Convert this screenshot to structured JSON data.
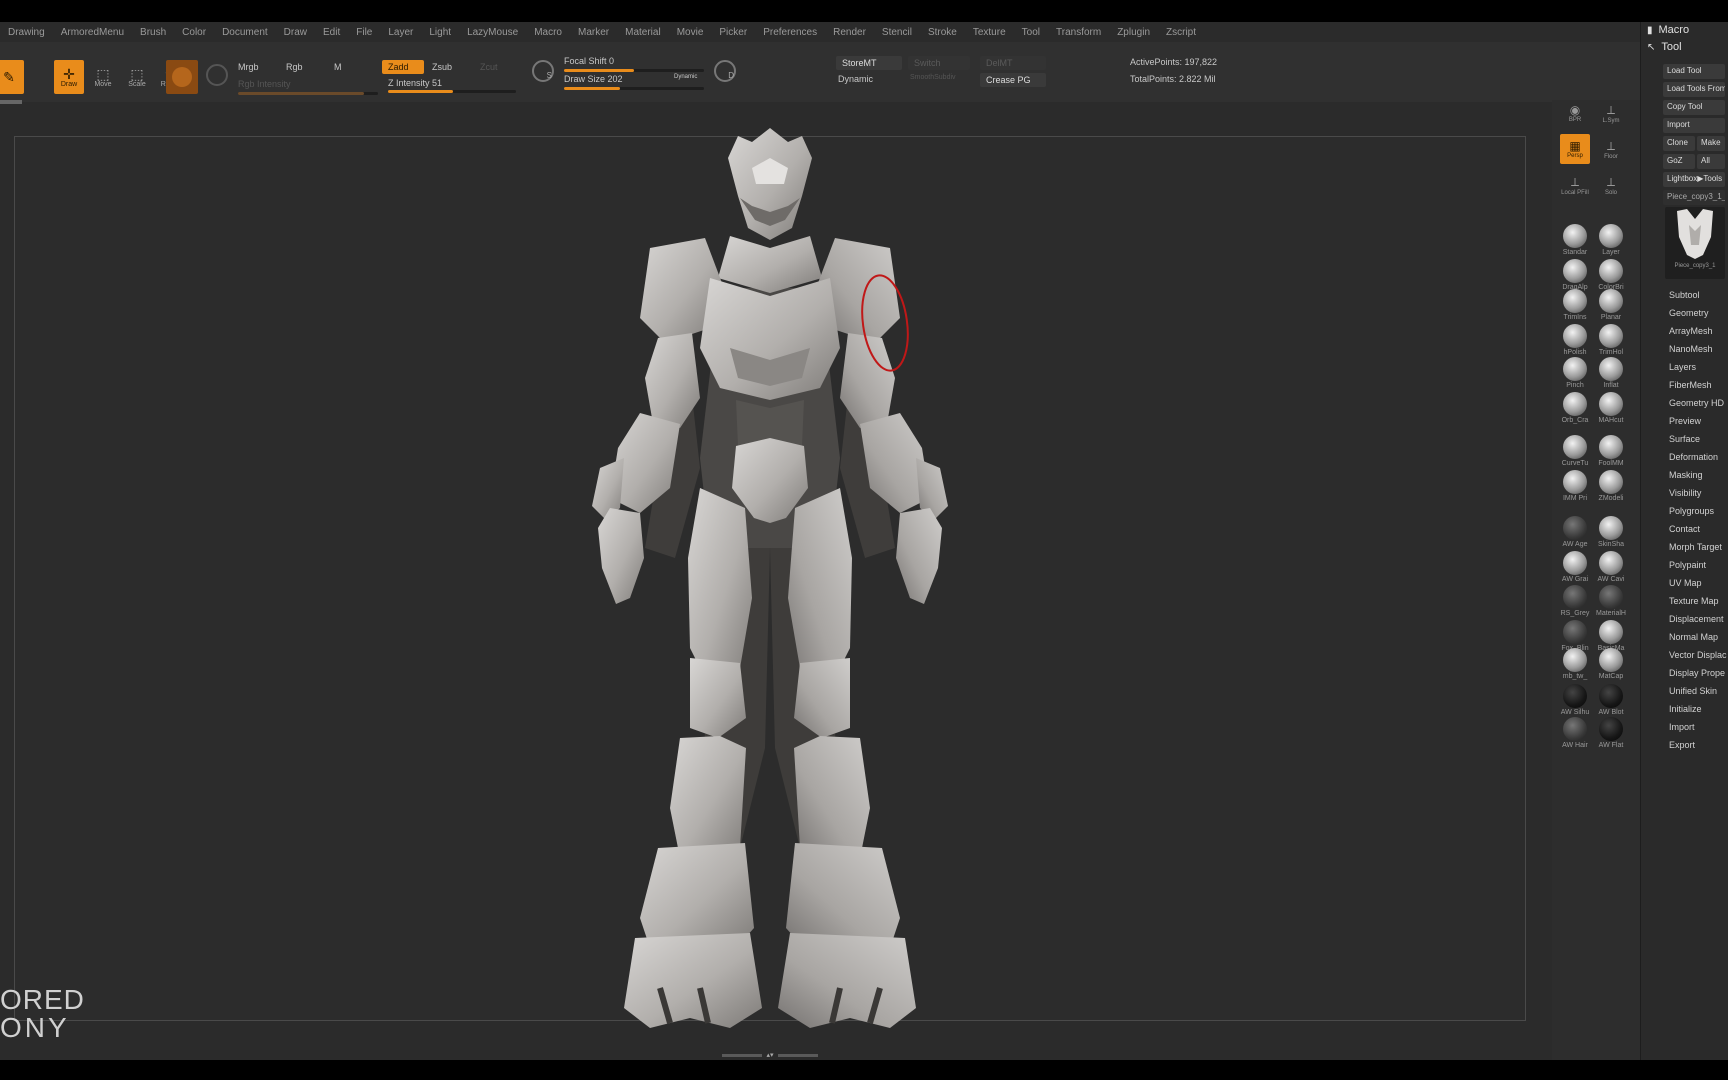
{
  "menu": [
    "Drawing",
    "ArmoredMenu",
    "Brush",
    "Color",
    "Document",
    "Draw",
    "Edit",
    "File",
    "Layer",
    "Light",
    "LazyMouse",
    "Macro",
    "Marker",
    "Material",
    "Movie",
    "Picker",
    "Preferences",
    "Render",
    "Stencil",
    "Stroke",
    "Texture",
    "Tool",
    "Transform",
    "Zplugin",
    "Zscript"
  ],
  "shelf": {
    "tools": [
      {
        "label": "",
        "glyph": "✎",
        "active": true
      },
      {
        "label": "Draw",
        "glyph": "✛",
        "active": true
      },
      {
        "label": "Move",
        "glyph": "⬚",
        "active": false
      },
      {
        "label": "Scale",
        "glyph": "⬚",
        "active": false
      },
      {
        "label": "Rotate",
        "glyph": "⟲",
        "active": false
      }
    ],
    "mrgb": "Mrgb",
    "rgb": "Rgb",
    "m": "M",
    "rgb_intensity": "Rgb Intensity",
    "zadd": "Zadd",
    "zsub": "Zsub",
    "zcut": "Zcut",
    "z_intensity": "Z Intensity 51",
    "focal_shift": "Focal Shift 0",
    "draw_size": "Draw Size 202",
    "dynamic_small": "Dynamic",
    "s_label": "S",
    "d_label": "D",
    "storemt": "StoreMT",
    "switch": "Switch",
    "delmt": "DelMT",
    "dynamic": "Dynamic",
    "smooth_subdiv": "SmoothSubdiv",
    "crease_pg": "Crease PG",
    "active_points": "ActivePoints: 197,822",
    "total_points": "TotalPoints: 2.822 Mil",
    "z_intensity_value": 0.51,
    "focal_shift_value": 0.5,
    "draw_size_value": 0.4,
    "rgb_intensity_value": 0.9
  },
  "watermark": {
    "line1": "ORED",
    "line2": "ONY"
  },
  "brush_palette": {
    "top_tiles": [
      {
        "label": "BPR",
        "orange": false
      },
      {
        "label": "L.Sym",
        "orange": false
      },
      {
        "label": "Persp",
        "orange": true
      },
      {
        "label": "Floor",
        "orange": false
      },
      {
        "label": "Local PFill",
        "orange": false
      },
      {
        "label": "Solo",
        "orange": false
      }
    ],
    "brushes": [
      {
        "label": "Standar",
        "style": ""
      },
      {
        "label": "Layer",
        "style": ""
      },
      {
        "label": "DragAlp",
        "style": ""
      },
      {
        "label": "ColorBri",
        "style": ""
      },
      {
        "label": "TrimIns",
        "style": ""
      },
      {
        "label": "Planar",
        "style": ""
      },
      {
        "label": "hPolish",
        "style": ""
      },
      {
        "label": "TrimHol",
        "style": ""
      },
      {
        "label": "Pinch",
        "style": ""
      },
      {
        "label": "Inflat",
        "style": ""
      },
      {
        "label": "Orb_Cra",
        "style": ""
      },
      {
        "label": "MAHcut",
        "style": ""
      },
      {
        "label": "CurveTu",
        "style": ""
      },
      {
        "label": "FoolMM",
        "style": ""
      },
      {
        "label": "IMM Pri",
        "style": ""
      },
      {
        "label": "ZModeli",
        "style": ""
      },
      {
        "label": "AW Age",
        "style": "dark"
      },
      {
        "label": "SkinSha",
        "style": ""
      },
      {
        "label": "AW Grai",
        "style": ""
      },
      {
        "label": "AW Cavi",
        "style": ""
      },
      {
        "label": "RS_Grey",
        "style": "dark"
      },
      {
        "label": "MaterialH",
        "style": "dark"
      },
      {
        "label": "Fox_Blin",
        "style": "dark"
      },
      {
        "label": "BasicMa",
        "style": ""
      },
      {
        "label": "mb_tw_",
        "style": ""
      },
      {
        "label": "MatCap",
        "style": ""
      },
      {
        "label": "AW Silhu",
        "style": "black"
      },
      {
        "label": "AW Blot",
        "style": "black"
      },
      {
        "label": "AW Hair",
        "style": "dark"
      },
      {
        "label": "AW Flat",
        "style": "black"
      }
    ]
  },
  "tool_palette": {
    "macro": "Macro",
    "tool": "Tool",
    "load_tool": "Load Tool",
    "load_tools_from": "Load Tools From",
    "copy_tool": "Copy Tool",
    "import": "Import",
    "clone": "Clone",
    "make": "Make",
    "goz": "GoZ",
    "all": "All",
    "lightbox": "Lightbox▶Tools",
    "current_tool": "Piece_copy3_1_",
    "thumb_label": "Piece_copy3_1",
    "subpalettes": [
      "Subtool",
      "Geometry",
      "ArrayMesh",
      "NanoMesh",
      "Layers",
      "FiberMesh",
      "Geometry HD",
      "Preview",
      "Surface",
      "Deformation",
      "Masking",
      "Visibility",
      "Polygroups",
      "Contact",
      "Morph Target",
      "Polypaint",
      "UV Map",
      "Texture Map",
      "Displacement",
      "Normal Map",
      "Vector Displac",
      "Display Prope",
      "Unified Skin",
      "Initialize",
      "Import",
      "Export"
    ]
  },
  "colors": {
    "accent": "#e98c1b",
    "background": "#2b2b2b",
    "model": "#c8c6c4"
  }
}
